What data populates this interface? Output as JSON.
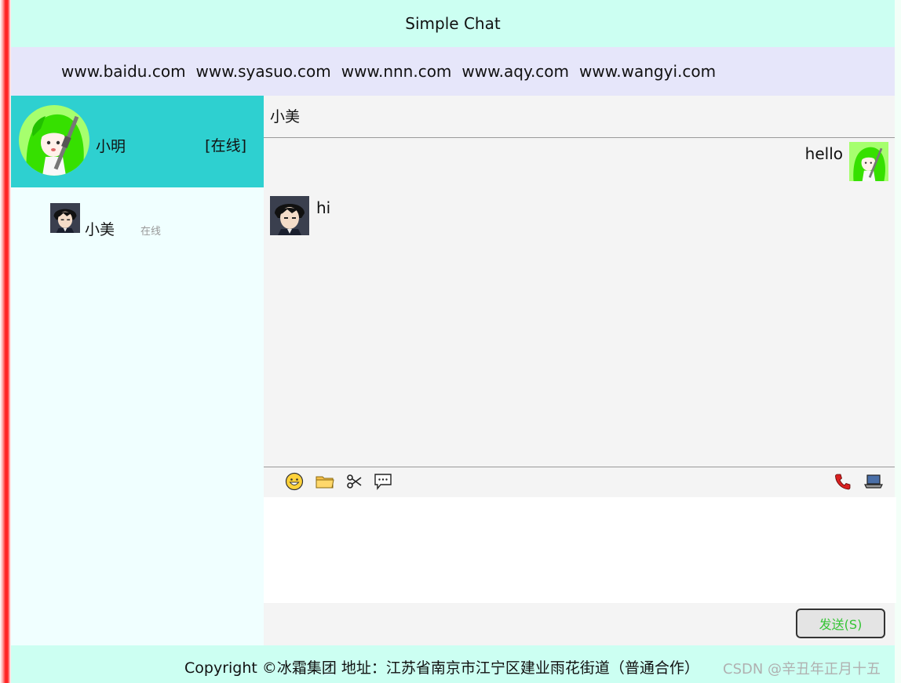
{
  "header": {
    "title": "Simple Chat"
  },
  "links": [
    "www.baidu.com",
    "www.syasuo.com",
    "www.nnn.com",
    "www.aqy.com",
    "www.wangyi.com"
  ],
  "me": {
    "name": "小明",
    "status": "[在线]"
  },
  "friends": [
    {
      "name": "小美",
      "status": "在线"
    }
  ],
  "chat": {
    "title": "小美",
    "messages": [
      {
        "side": "right",
        "text": "hello"
      },
      {
        "side": "left",
        "text": "hi"
      }
    ]
  },
  "toolbar": {
    "icons": [
      "smiley-icon",
      "folder-icon",
      "scissors-icon",
      "chat-bubble-icon",
      "phone-icon",
      "laptop-icon"
    ]
  },
  "send": {
    "label": "发送(S)"
  },
  "footer": {
    "copyright": "Copyright ©冰霜集团 地址：江苏省南京市江宁区建业雨花街道（普通合作）",
    "watermark": "CSDN @辛丑年正月十五"
  },
  "colors": {
    "header_bg": "#ccfff2",
    "linkbar_bg": "#e6e6fa",
    "me_bg": "#2ed0d0",
    "sidebar_bg": "#f0ffff",
    "chat_bg": "#f4f4f4",
    "send_text": "#35c435",
    "left_border": "#ff2020"
  }
}
